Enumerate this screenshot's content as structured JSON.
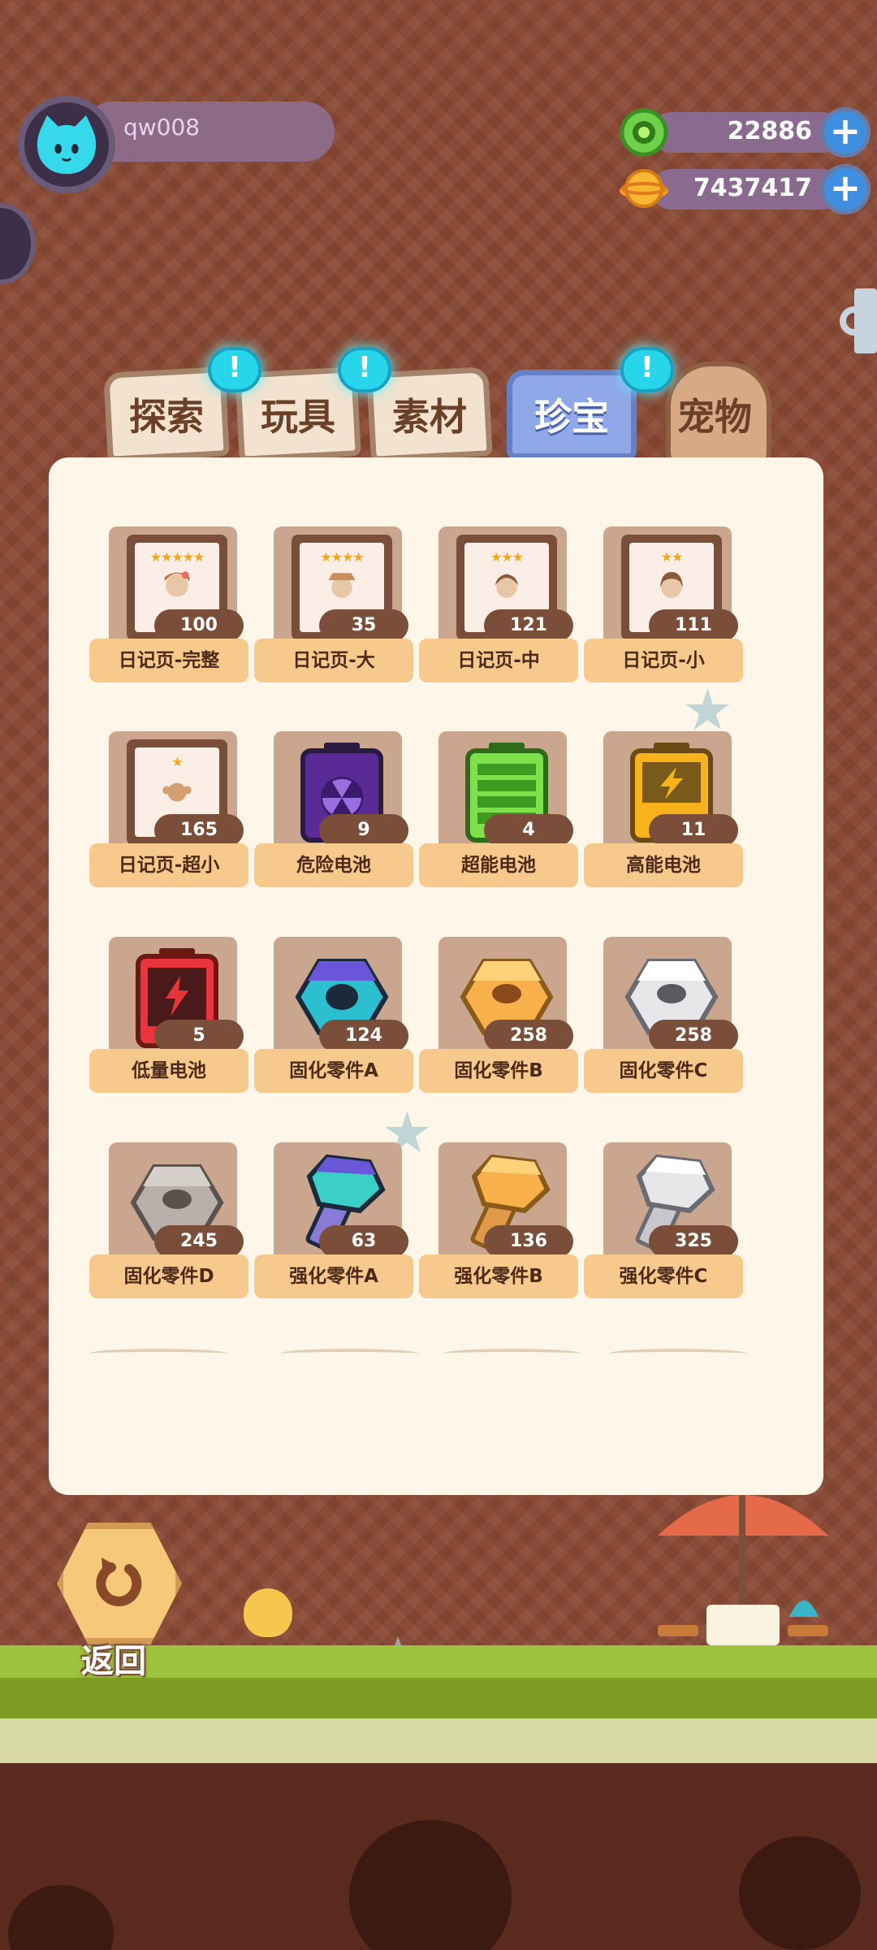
{
  "player": {
    "username": "qw008"
  },
  "currencies": [
    {
      "amount": "22886",
      "icon": "green-gem-icon",
      "color": "#5cc23a"
    },
    {
      "amount": "7437417",
      "icon": "gold-coin-icon",
      "color": "#f2a623"
    }
  ],
  "tabs": [
    {
      "label": "探索",
      "has_alert": false
    },
    {
      "label": "玩具",
      "has_alert": true
    },
    {
      "label": "素材",
      "has_alert": true
    },
    {
      "label": "珍宝",
      "active": true,
      "has_alert": false
    },
    {
      "label": "宠物",
      "has_alert": true
    }
  ],
  "alert_badge": "!",
  "items": [
    {
      "name": "日记页-完整",
      "count": "100",
      "icon": "diary-page-icon",
      "stars": "★★★★★"
    },
    {
      "name": "日记页-大",
      "count": "35",
      "icon": "diary-page-icon",
      "stars": "★★★★"
    },
    {
      "name": "日记页-中",
      "count": "121",
      "icon": "diary-page-icon",
      "stars": "★★★"
    },
    {
      "name": "日记页-小",
      "count": "111",
      "icon": "diary-page-icon",
      "stars": "★★"
    },
    {
      "name": "日记页-超小",
      "count": "165",
      "icon": "diary-page-icon",
      "stars": "★"
    },
    {
      "name": "危险电池",
      "count": "9",
      "icon": "radioactive-battery-icon"
    },
    {
      "name": "超能电池",
      "count": "4",
      "icon": "green-battery-icon"
    },
    {
      "name": "高能电池",
      "count": "11",
      "icon": "yellow-battery-icon"
    },
    {
      "name": "低量电池",
      "count": "5",
      "icon": "red-battery-icon"
    },
    {
      "name": "固化零件A",
      "count": "124",
      "icon": "iridescent-nut-icon"
    },
    {
      "name": "固化零件B",
      "count": "258",
      "icon": "gold-nut-icon"
    },
    {
      "name": "固化零件C",
      "count": "258",
      "icon": "silver-nut-icon"
    },
    {
      "name": "固化零件D",
      "count": "245",
      "icon": "iron-nut-icon"
    },
    {
      "name": "强化零件A",
      "count": "63",
      "icon": "iridescent-bolt-icon"
    },
    {
      "name": "强化零件B",
      "count": "136",
      "icon": "gold-bolt-icon"
    },
    {
      "name": "强化零件C",
      "count": "325",
      "icon": "silver-bolt-icon"
    }
  ],
  "back_button": {
    "label": "返回"
  }
}
